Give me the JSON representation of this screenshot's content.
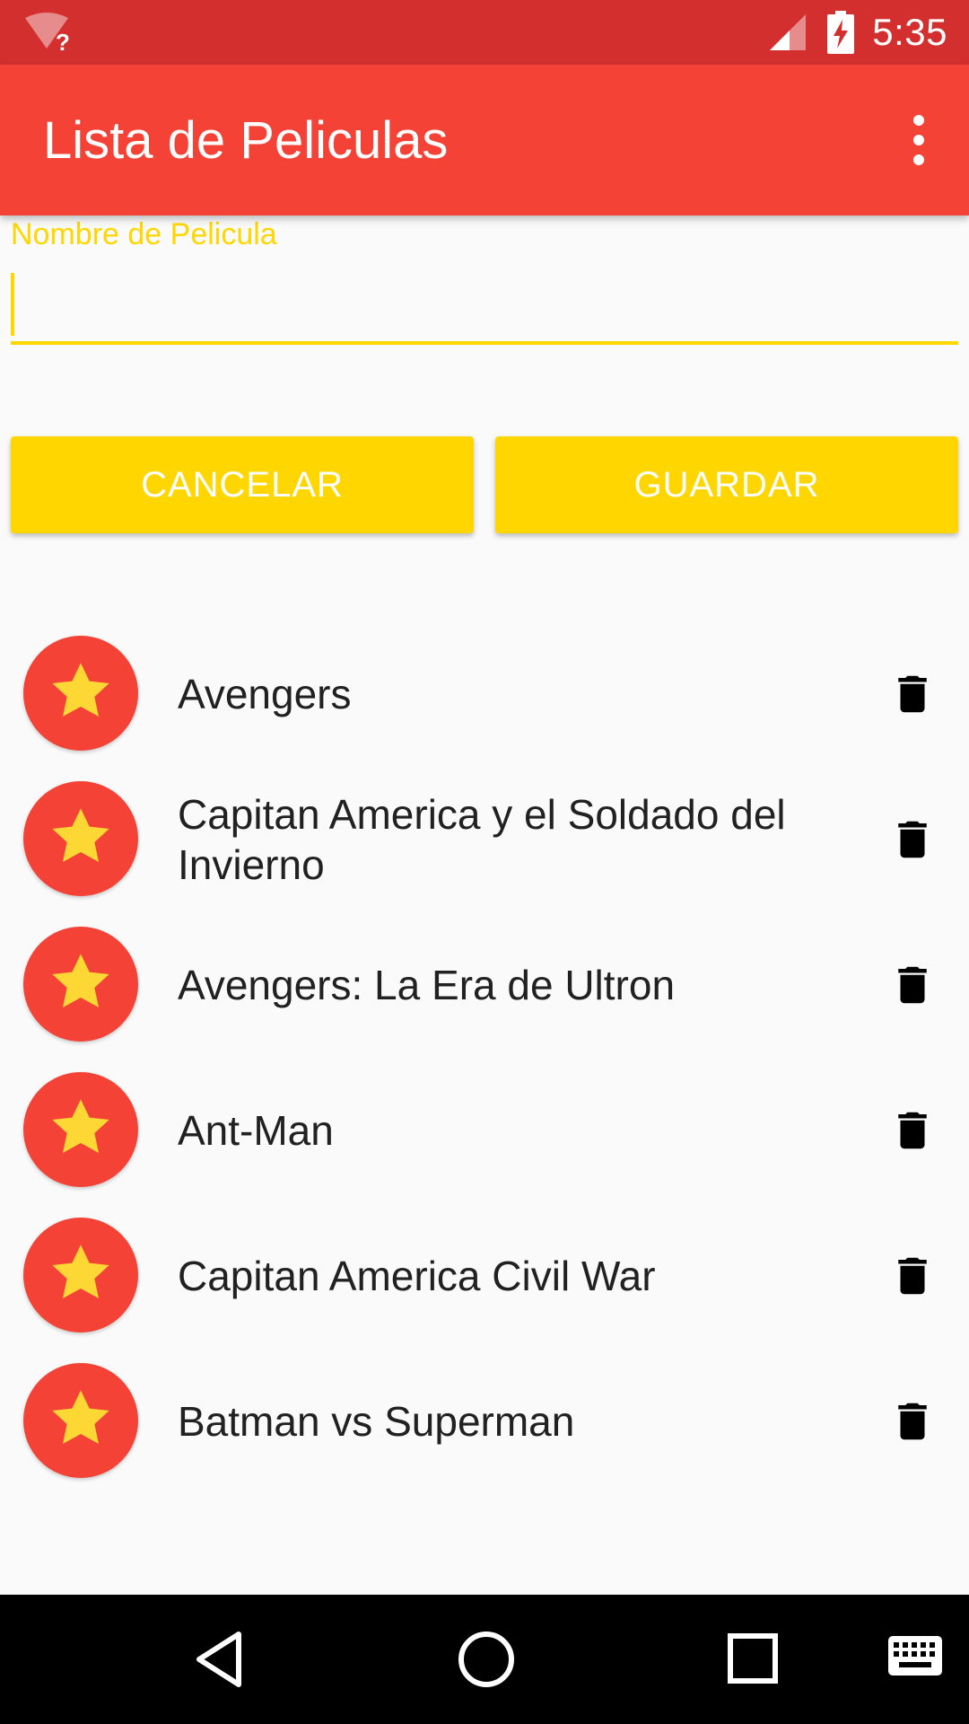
{
  "status_bar": {
    "time": "5:35",
    "wifi_badge": "?",
    "icons": [
      "wifi-unknown-icon",
      "cell-signal-icon",
      "battery-charging-icon"
    ]
  },
  "app_bar": {
    "title": "Lista de Peliculas",
    "menu_icon": "more-vert-icon"
  },
  "form": {
    "field_label": "Nombre de Pelicula",
    "field_value": "",
    "cancel_label": "CANCELAR",
    "save_label": "GUARDAR"
  },
  "movies": [
    {
      "title": "Avengers"
    },
    {
      "title": "Capitan America y el Soldado del Invierno"
    },
    {
      "title": "Avengers: La Era de Ultron"
    },
    {
      "title": "Ant-Man"
    },
    {
      "title": "Capitan America Civil War"
    },
    {
      "title": "Batman vs Superman"
    }
  ],
  "nav_bar": {
    "icons": [
      "back-icon",
      "home-icon",
      "recents-icon",
      "keyboard-icon"
    ]
  },
  "colors": {
    "status_bar": "#d32f2f",
    "app_bar": "#f44336",
    "accent": "#ffd600",
    "avatar": "#f44336",
    "star": "#fdd835"
  }
}
